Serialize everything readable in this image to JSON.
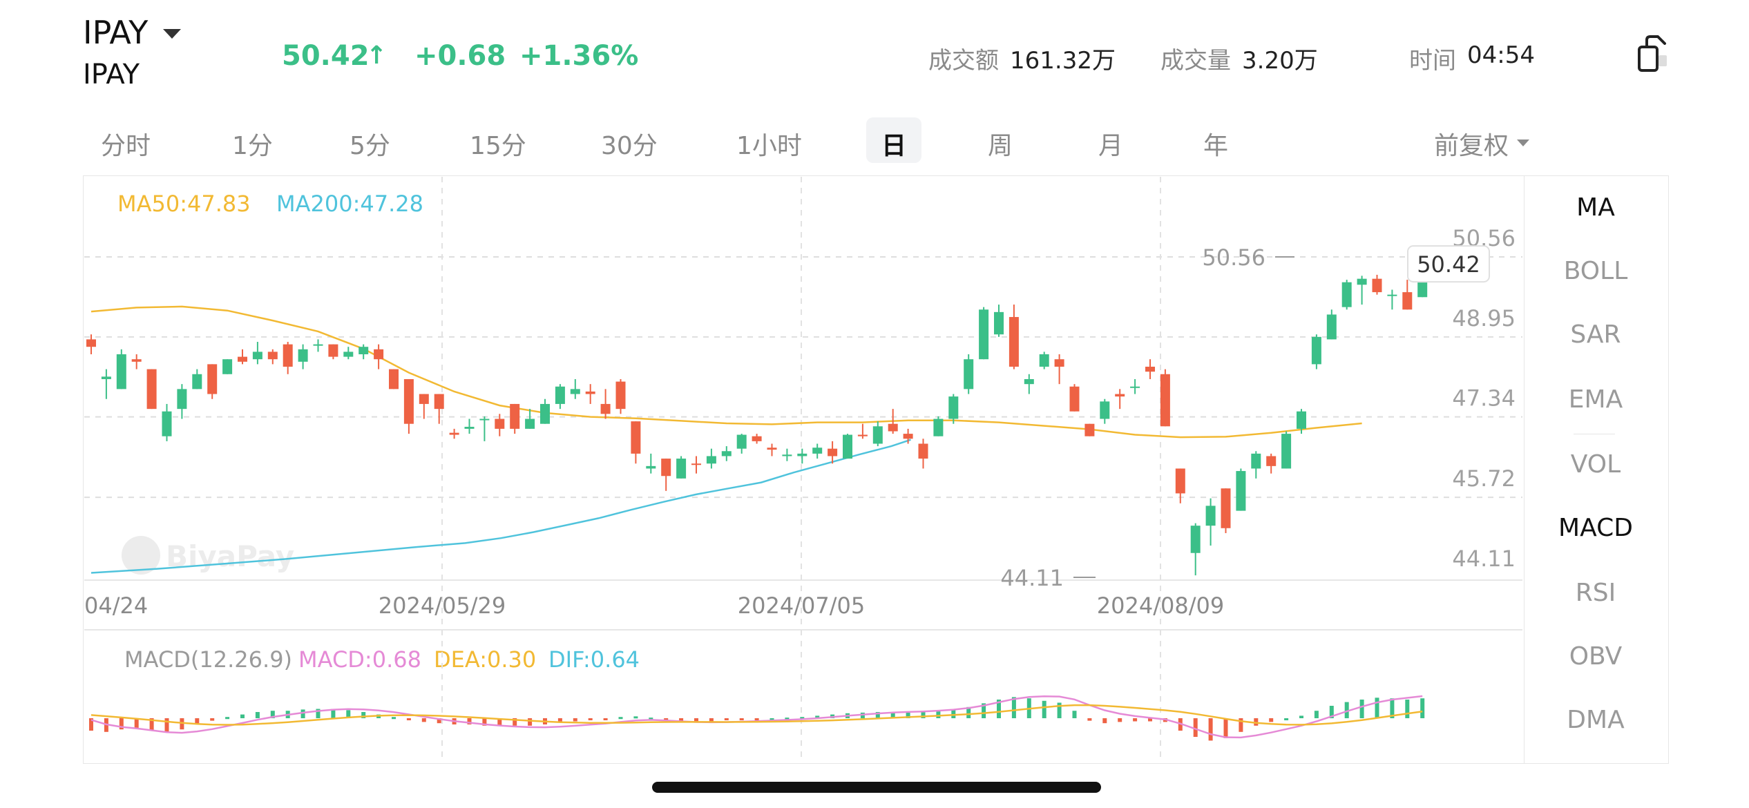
{
  "header": {
    "symbol": "IPAY",
    "symbol_sub": "IPAY",
    "price": "50.42",
    "price_arrow": "↑",
    "change": "+0.68",
    "change_pct": "+1.36%",
    "turnover_label": "成交额",
    "turnover_value": "161.32万",
    "volume_label": "成交量",
    "volume_value": "3.20万",
    "time_label": "时间",
    "time_value": "04:54",
    "share_icon": "share-icon"
  },
  "period_tabs": [
    "分时",
    "1分",
    "5分",
    "15分",
    "30分",
    "1小时",
    "日",
    "周",
    "月",
    "年"
  ],
  "active_tab": "日",
  "adjust_label": "前复权",
  "indicators": [
    "MA",
    "BOLL",
    "SAR",
    "EMA",
    "VOL",
    "MACD",
    "RSI",
    "OBV",
    "DMA"
  ],
  "active_indicators": [
    "MA",
    "MACD"
  ],
  "ma_legend": {
    "ma50": "MA50:47.83",
    "ma200": "MA200:47.28"
  },
  "macd_legend": {
    "params": "MACD(12.26.9)",
    "macd": "MACD:0.68",
    "dea": "DEA:0.30",
    "dif": "DIF:0.64"
  },
  "colors": {
    "up": "#3bbf88",
    "down": "#ee6244",
    "ma50": "#f2b933",
    "ma200": "#4fc3dc",
    "dif": "#e58ad6",
    "dea": "#f2b933"
  },
  "watermark": "BiyaPay",
  "chart_data": {
    "type": "candlestick",
    "y_axis_labels": [
      "50.56",
      "48.95",
      "47.34",
      "45.72",
      "44.11"
    ],
    "ylim": [
      44.11,
      50.56
    ],
    "x_axis_labels": [
      "04/24",
      "2024/05/29",
      "2024/07/05",
      "2024/08/09"
    ],
    "high_marker": "50.56",
    "low_marker": "44.11",
    "last_price_tag": "50.42",
    "candles": [
      [
        48.9,
        48.75,
        49.0,
        48.6
      ],
      [
        48.1,
        48.15,
        48.3,
        47.7
      ],
      [
        47.9,
        48.6,
        48.7,
        47.9
      ],
      [
        48.5,
        48.45,
        48.6,
        48.3
      ],
      [
        48.3,
        47.5,
        48.3,
        47.5
      ],
      [
        46.95,
        47.45,
        47.6,
        46.85
      ],
      [
        47.5,
        47.9,
        48.0,
        47.3
      ],
      [
        47.9,
        48.2,
        48.3,
        47.9
      ],
      [
        48.4,
        47.8,
        48.4,
        47.7
      ],
      [
        48.2,
        48.5,
        48.5,
        48.2
      ],
      [
        48.55,
        48.45,
        48.7,
        48.4
      ],
      [
        48.5,
        48.65,
        48.85,
        48.4
      ],
      [
        48.65,
        48.5,
        48.7,
        48.4
      ],
      [
        48.8,
        48.35,
        48.85,
        48.2
      ],
      [
        48.45,
        48.7,
        48.8,
        48.3
      ],
      [
        48.78,
        48.8,
        48.9,
        48.65
      ],
      [
        48.8,
        48.55,
        48.8,
        48.5
      ],
      [
        48.55,
        48.65,
        48.75,
        48.5
      ],
      [
        48.6,
        48.75,
        48.8,
        48.5
      ],
      [
        48.7,
        48.5,
        48.8,
        48.3
      ],
      [
        48.3,
        47.9,
        48.3,
        47.9
      ],
      [
        48.1,
        47.2,
        48.1,
        47.0
      ],
      [
        47.8,
        47.6,
        47.8,
        47.3
      ],
      [
        47.8,
        47.5,
        47.8,
        47.2
      ],
      [
        47.02,
        46.98,
        47.1,
        46.9
      ],
      [
        47.1,
        47.14,
        47.3,
        47.0
      ],
      [
        47.3,
        47.3,
        47.35,
        46.85
      ],
      [
        47.3,
        47.1,
        47.4,
        46.95
      ],
      [
        47.6,
        47.1,
        47.6,
        47.0
      ],
      [
        47.1,
        47.3,
        47.5,
        47.1
      ],
      [
        47.2,
        47.6,
        47.7,
        47.2
      ],
      [
        47.6,
        47.95,
        48.0,
        47.5
      ],
      [
        47.8,
        47.9,
        48.1,
        47.7
      ],
      [
        47.85,
        47.8,
        48.0,
        47.6
      ],
      [
        47.6,
        47.4,
        47.9,
        47.3
      ],
      [
        48.05,
        47.5,
        48.1,
        47.4
      ],
      [
        47.25,
        46.6,
        47.25,
        46.4
      ],
      [
        46.3,
        46.35,
        46.6,
        46.2
      ],
      [
        46.5,
        46.15,
        46.5,
        45.85
      ],
      [
        46.1,
        46.5,
        46.55,
        46.1
      ],
      [
        46.4,
        46.38,
        46.55,
        46.2
      ],
      [
        46.4,
        46.55,
        46.7,
        46.3
      ],
      [
        46.55,
        46.65,
        46.75,
        46.45
      ],
      [
        46.7,
        46.98,
        47.0,
        46.6
      ],
      [
        46.95,
        46.85,
        47.0,
        46.8
      ],
      [
        46.72,
        46.68,
        46.8,
        46.55
      ],
      [
        46.55,
        46.58,
        46.7,
        46.45
      ],
      [
        46.55,
        46.6,
        46.7,
        46.4
      ],
      [
        46.6,
        46.72,
        46.8,
        46.5
      ],
      [
        46.7,
        46.55,
        46.85,
        46.4
      ],
      [
        46.5,
        46.98,
        47.0,
        46.5
      ],
      [
        46.98,
        46.95,
        47.2,
        46.9
      ],
      [
        46.8,
        47.15,
        47.25,
        46.75
      ],
      [
        47.2,
        47.05,
        47.5,
        47.0
      ],
      [
        47.0,
        46.9,
        47.1,
        46.8
      ],
      [
        46.8,
        46.5,
        46.9,
        46.3
      ],
      [
        46.95,
        47.3,
        47.35,
        46.95
      ],
      [
        47.3,
        47.75,
        47.8,
        47.2
      ],
      [
        47.9,
        48.5,
        48.6,
        47.8
      ],
      [
        48.5,
        49.5,
        49.55,
        48.5
      ],
      [
        49.0,
        49.45,
        49.6,
        48.95
      ],
      [
        49.35,
        48.35,
        49.6,
        48.3
      ],
      [
        48.0,
        48.1,
        48.2,
        47.8
      ],
      [
        48.35,
        48.6,
        48.65,
        48.3
      ],
      [
        48.5,
        48.35,
        48.6,
        48.0
      ],
      [
        47.95,
        47.45,
        48.0,
        47.45
      ],
      [
        47.2,
        46.95,
        47.2,
        46.95
      ],
      [
        47.3,
        47.65,
        47.7,
        47.2
      ],
      [
        47.8,
        47.75,
        47.9,
        47.5
      ],
      [
        47.95,
        47.95,
        48.1,
        47.8
      ],
      [
        48.35,
        48.25,
        48.5,
        48.1
      ],
      [
        48.2,
        47.15,
        48.3,
        47.15
      ],
      [
        46.3,
        45.8,
        46.3,
        45.6
      ],
      [
        44.6,
        45.15,
        45.2,
        44.15
      ],
      [
        45.15,
        45.55,
        45.7,
        44.75
      ],
      [
        45.9,
        45.1,
        45.9,
        45.0
      ],
      [
        45.45,
        46.25,
        46.3,
        45.45
      ],
      [
        46.3,
        46.6,
        46.65,
        46.1
      ],
      [
        46.55,
        46.35,
        46.6,
        46.2
      ],
      [
        46.3,
        47.0,
        47.05,
        46.3
      ],
      [
        47.1,
        47.45,
        47.5,
        47.0
      ],
      [
        48.4,
        48.95,
        49.0,
        48.3
      ],
      [
        48.9,
        49.4,
        49.5,
        48.9
      ],
      [
        49.55,
        50.05,
        50.1,
        49.5
      ],
      [
        50.0,
        50.12,
        50.18,
        49.6
      ],
      [
        50.12,
        49.85,
        50.2,
        49.8
      ],
      [
        49.78,
        49.8,
        49.9,
        49.5
      ],
      [
        49.85,
        49.5,
        50.1,
        49.5
      ],
      [
        49.75,
        50.42,
        50.56,
        49.75
      ]
    ],
    "ma50": [
      [
        0,
        49.46
      ],
      [
        6,
        49.54
      ],
      [
        12,
        49.56
      ],
      [
        18,
        49.48
      ],
      [
        24,
        49.28
      ],
      [
        30,
        49.06
      ],
      [
        36,
        48.71
      ],
      [
        42,
        48.23
      ],
      [
        48,
        47.85
      ],
      [
        54,
        47.57
      ],
      [
        60,
        47.42
      ],
      [
        66,
        47.34
      ],
      [
        72,
        47.31
      ],
      [
        78,
        47.26
      ],
      [
        84,
        47.21
      ],
      [
        90,
        47.19
      ],
      [
        96,
        47.23
      ],
      [
        102,
        47.23
      ],
      [
        108,
        47.27
      ],
      [
        114,
        47.27
      ],
      [
        120,
        47.23
      ],
      [
        126,
        47.16
      ],
      [
        132,
        47.09
      ],
      [
        138,
        46.98
      ],
      [
        144,
        46.93
      ],
      [
        150,
        46.94
      ],
      [
        156,
        47.02
      ],
      [
        162,
        47.12
      ],
      [
        168,
        47.21
      ]
    ],
    "ma200": [
      [
        0,
        44.2
      ],
      [
        20,
        44.28
      ],
      [
        40,
        44.38
      ],
      [
        60,
        44.48
      ],
      [
        80,
        44.6
      ],
      [
        100,
        44.72
      ],
      [
        115,
        44.8
      ],
      [
        126,
        44.9
      ],
      [
        136,
        45.02
      ],
      [
        146,
        45.16
      ],
      [
        156,
        45.3
      ],
      [
        166,
        45.47
      ],
      [
        176,
        45.63
      ],
      [
        186,
        45.78
      ],
      [
        196,
        45.9
      ],
      [
        206,
        46.02
      ],
      [
        216,
        46.22
      ],
      [
        226,
        46.4
      ],
      [
        236,
        46.58
      ],
      [
        246,
        46.75
      ],
      [
        252,
        46.88
      ]
    ],
    "macd_hist": [
      -0.2,
      -0.22,
      -0.18,
      -0.16,
      -0.2,
      -0.22,
      -0.18,
      -0.1,
      -0.04,
      0.02,
      0.06,
      0.1,
      0.12,
      0.12,
      0.14,
      0.15,
      0.15,
      0.13,
      0.1,
      0.06,
      0.02,
      -0.03,
      -0.06,
      -0.08,
      -0.1,
      -0.1,
      -0.12,
      -0.12,
      -0.12,
      -0.12,
      -0.1,
      -0.07,
      -0.05,
      -0.03,
      -0.02,
      0.02,
      0.03,
      0.01,
      -0.04,
      -0.06,
      -0.06,
      -0.05,
      -0.03,
      -0.02,
      -0.01,
      0.0,
      0.01,
      0.02,
      0.04,
      0.06,
      0.08,
      0.09,
      0.1,
      0.1,
      0.1,
      0.1,
      0.12,
      0.14,
      0.18,
      0.24,
      0.3,
      0.34,
      0.32,
      0.28,
      0.25,
      0.12,
      -0.04,
      -0.08,
      -0.06,
      -0.05,
      -0.05,
      -0.06,
      -0.2,
      -0.3,
      -0.36,
      -0.32,
      -0.22,
      -0.12,
      -0.06,
      0.0,
      0.04,
      0.12,
      0.2,
      0.26,
      0.3,
      0.33,
      0.32,
      0.3,
      0.32
    ]
  }
}
